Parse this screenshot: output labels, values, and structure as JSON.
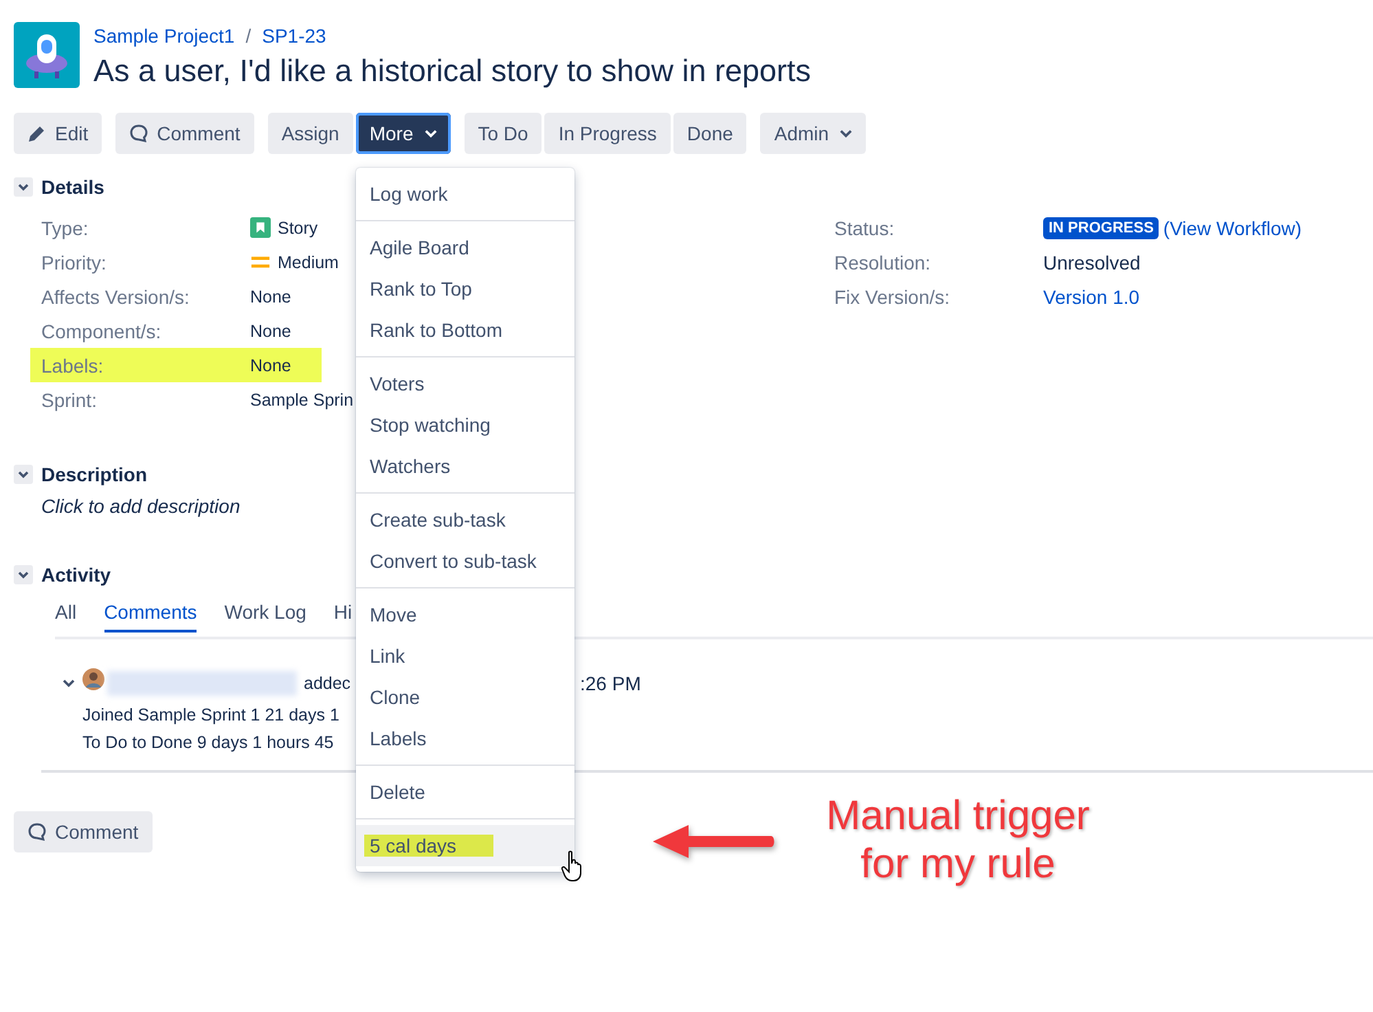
{
  "breadcrumb": {
    "project": "Sample Project1",
    "separator": "/",
    "issue_key": "SP1-23"
  },
  "title": "As a user, I'd like a historical story to show in reports",
  "toolbar": [
    [
      {
        "label": "Edit",
        "kind": "edit",
        "selected": false,
        "dropdown": false
      }
    ],
    [
      {
        "label": "Comment",
        "kind": "comment",
        "selected": false,
        "dropdown": false
      }
    ],
    [
      {
        "label": "Assign",
        "kind": "plain",
        "selected": false,
        "dropdown": false
      },
      {
        "label": "More",
        "kind": "plain",
        "selected": true,
        "dropdown": true
      }
    ],
    [
      {
        "label": "To Do",
        "kind": "plain",
        "selected": false,
        "dropdown": false
      },
      {
        "label": "In Progress",
        "kind": "plain",
        "selected": false,
        "dropdown": false
      },
      {
        "label": "Done",
        "kind": "plain",
        "selected": false,
        "dropdown": false
      }
    ],
    [
      {
        "label": "Admin",
        "kind": "plain",
        "selected": false,
        "dropdown": true
      }
    ]
  ],
  "details": {
    "heading": "Details",
    "expanded": true,
    "left_fields": [
      {
        "label": "Type:",
        "value": "Story",
        "kind": "story",
        "highlighted": false
      },
      {
        "label": "Priority:",
        "value": "Medium",
        "kind": "priority",
        "highlighted": false
      },
      {
        "label": "Affects Version/s:",
        "value": "None",
        "kind": "text",
        "highlighted": false
      },
      {
        "label": "Component/s:",
        "value": "None",
        "kind": "text",
        "highlighted": false
      },
      {
        "label": "Labels:",
        "value": "None",
        "kind": "text",
        "highlighted": true
      },
      {
        "label": "Sprint:",
        "value": "Sample Sprin",
        "kind": "text",
        "highlighted": false
      }
    ],
    "right_fields": [
      {
        "label": "Status:",
        "value": "IN PROGRESS",
        "link": "(View Workflow)",
        "kind": "status"
      },
      {
        "label": "Resolution:",
        "value": "Unresolved",
        "kind": "text"
      },
      {
        "label": "Fix Version/s:",
        "value": "Version 1.0",
        "kind": "link"
      }
    ]
  },
  "description": {
    "heading": "Description",
    "expanded": true,
    "hint": "Click to add description"
  },
  "activity": {
    "heading": "Activity",
    "expanded": true,
    "tabs": [
      {
        "label": "All",
        "selected": false
      },
      {
        "label": "Comments",
        "selected": true
      },
      {
        "label": "Work Log",
        "selected": false
      },
      {
        "label": "Hi",
        "selected": false
      }
    ],
    "entry": {
      "expanded": true,
      "action": "addec",
      "time": ":26 PM",
      "lines": [
        "Joined Sample Sprint 1 21 days 1",
        "To Do to Done 9 days 1 hours 45"
      ]
    },
    "comment_button": "Comment"
  },
  "menu": {
    "groups": [
      [
        {
          "label": "Log work",
          "hovered": false,
          "highlighted": false
        }
      ],
      [
        {
          "label": "Agile Board",
          "hovered": false,
          "highlighted": false
        },
        {
          "label": "Rank to Top",
          "hovered": false,
          "highlighted": false
        },
        {
          "label": "Rank to Bottom",
          "hovered": false,
          "highlighted": false
        }
      ],
      [
        {
          "label": "Voters",
          "hovered": false,
          "highlighted": false
        },
        {
          "label": "Stop watching",
          "hovered": false,
          "highlighted": false
        },
        {
          "label": "Watchers",
          "hovered": false,
          "highlighted": false
        }
      ],
      [
        {
          "label": "Create sub-task",
          "hovered": false,
          "highlighted": false
        },
        {
          "label": "Convert to sub-task",
          "hovered": false,
          "highlighted": false
        }
      ],
      [
        {
          "label": "Move",
          "hovered": false,
          "highlighted": false
        },
        {
          "label": "Link",
          "hovered": false,
          "highlighted": false
        },
        {
          "label": "Clone",
          "hovered": false,
          "highlighted": false
        },
        {
          "label": "Labels",
          "hovered": false,
          "highlighted": false
        }
      ],
      [
        {
          "label": "Delete",
          "hovered": false,
          "highlighted": false
        }
      ],
      [
        {
          "label": "5 cal days",
          "hovered": true,
          "highlighted": true
        }
      ]
    ]
  },
  "annotation": {
    "text": "Manual trigger\nfor my rule"
  }
}
